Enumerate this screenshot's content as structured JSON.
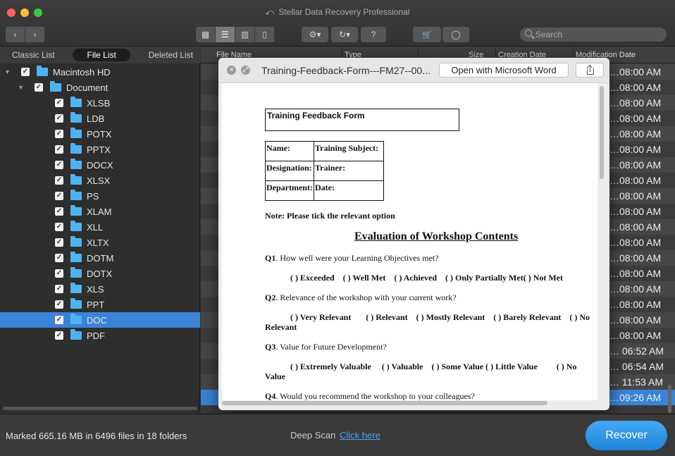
{
  "window": {
    "title": "Stellar Data Recovery Professional"
  },
  "colors": {
    "accent": "#3a84d8",
    "folder": "#4fb3f1",
    "recover": "#2f95e8",
    "link": "#4aa3ef"
  },
  "toolbar": {
    "back_icon": "chevron-left-icon",
    "forward_icon": "chevron-right-icon",
    "views": [
      "grid-view-icon",
      "list-view-icon",
      "column-view-icon",
      "coverflow-view-icon"
    ],
    "active_view": "list-view-icon",
    "settings_icon": "gear-icon",
    "history_icon": "history-icon",
    "help_label": "?",
    "cart_icon": "cart-icon",
    "account_icon": "user-icon",
    "search_placeholder": "Search"
  },
  "view_tabs": [
    "Classic List",
    "File List",
    "Deleted List"
  ],
  "active_view_tab": "File List",
  "tree": {
    "root": "Macintosh HD",
    "child": "Document",
    "folders": [
      "XLSB",
      "LDB",
      "POTX",
      "PPTX",
      "DOCX",
      "XLSX",
      "PS",
      "XLAM",
      "XLL",
      "XLTX",
      "DOTM",
      "DOTX",
      "XLS",
      "PPT",
      "DOC",
      "PDF"
    ],
    "selected": "DOC"
  },
  "table": {
    "columns": [
      "File Name",
      "Type",
      "Size",
      "Creation Date",
      "Modification Date"
    ],
    "modification_dates": [
      "…08:00 AM",
      "…08:00 AM",
      "…08:00 AM",
      "…08:00 AM",
      "…08:00 AM",
      "…08:00 AM",
      "…08:00 AM",
      "…08:00 AM",
      "…08:00 AM",
      "…08:00 AM",
      "…08:00 AM",
      "…08:00 AM",
      "…08:00 AM",
      "…08:00 AM",
      "…08:00 AM",
      "…08:00 AM",
      "…08:00 AM",
      "…08:00 AM",
      "… 06:52 AM",
      "… 06:54 AM",
      "… 11:53 AM",
      "…09:26 AM"
    ],
    "selected_index": 21
  },
  "preview": {
    "title": "Training-Feedback-Form---FM27--00...",
    "open_button": "Open with Microsoft Word",
    "share_icon": "share-icon",
    "document": {
      "form_title": "Training Feedback Form",
      "info_table": [
        [
          "Name:",
          "Training Subject:"
        ],
        [
          "Designation:",
          "Trainer:"
        ],
        [
          "Department:",
          "Date:"
        ]
      ],
      "note": "Note: Please tick the relevant option",
      "heading": "Evaluation of Workshop Contents",
      "q1_num": "Q1",
      "q1": ". How well were your Learning Objectives met?",
      "q1_options": "( ) Exceeded    ( ) Well Met    ( ) Achieved    ( ) Only Partially Met( ) Not Met",
      "q2_num": "Q2",
      "q2": ". Relevance of the workshop with your current work?",
      "q2_options": "( ) Very Relevant       ( ) Relevant    ( ) Mostly Relevant    ( ) Barely Relevant    ( ) No",
      "q2_wrap": "Relevant",
      "q3_num": "Q3",
      "q3": ". Value for Future Development?",
      "q3_options": "( ) Extremely Valuable     ( ) Valuable    ( ) Some Value ( ) Little Value         ( ) No",
      "q3_wrap": "Value",
      "q4_num": "Q4",
      "q4": ". Would you recommend the workshop to your colleagues?"
    }
  },
  "bottom": {
    "status": "Marked 665.16 MB in 6496 files in 18 folders",
    "deep_scan_label": "Deep Scan",
    "deep_scan_link": "Click here",
    "recover_button": "Recover"
  }
}
